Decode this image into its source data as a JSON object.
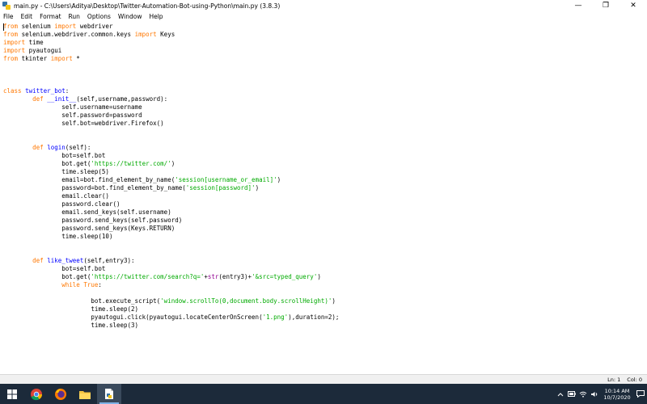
{
  "window": {
    "title": "main.py - C:\\Users\\Aditya\\Desktop\\Twitter-Automation-Bot-using-Python\\main.py (3.8.3)",
    "minimize_glyph": "—",
    "maximize_glyph": "❐",
    "close_glyph": "✕"
  },
  "menu": {
    "items": [
      "File",
      "Edit",
      "Format",
      "Run",
      "Options",
      "Window",
      "Help"
    ]
  },
  "code": {
    "lines": [
      [
        [
          "kw",
          "from"
        ],
        [
          "t",
          " selenium "
        ],
        [
          "kw",
          "import"
        ],
        [
          "t",
          " webdriver"
        ]
      ],
      [
        [
          "kw",
          "from"
        ],
        [
          "t",
          " selenium.webdriver.common.keys "
        ],
        [
          "kw",
          "import"
        ],
        [
          "t",
          " Keys"
        ]
      ],
      [
        [
          "kw",
          "import"
        ],
        [
          "t",
          " time"
        ]
      ],
      [
        [
          "kw",
          "import"
        ],
        [
          "t",
          " pyautogui"
        ]
      ],
      [
        [
          "kw",
          "from"
        ],
        [
          "t",
          " tkinter "
        ],
        [
          "kw",
          "import"
        ],
        [
          "t",
          " *"
        ]
      ],
      [],
      [],
      [],
      [
        [
          "kw",
          "class"
        ],
        [
          "t",
          " "
        ],
        [
          "def",
          "twitter_bot"
        ],
        [
          "t",
          ":"
        ]
      ],
      [
        [
          "t",
          "        "
        ],
        [
          "kw",
          "def"
        ],
        [
          "t",
          " "
        ],
        [
          "def",
          "__init__"
        ],
        [
          "t",
          "(self,username,password):"
        ]
      ],
      [
        [
          "t",
          "                self.username=username"
        ]
      ],
      [
        [
          "t",
          "                self.password=password"
        ]
      ],
      [
        [
          "t",
          "                self.bot=webdriver.Firefox()"
        ]
      ],
      [],
      [],
      [
        [
          "t",
          "        "
        ],
        [
          "kw",
          "def"
        ],
        [
          "t",
          " "
        ],
        [
          "def",
          "login"
        ],
        [
          "t",
          "(self):"
        ]
      ],
      [
        [
          "t",
          "                bot=self.bot"
        ]
      ],
      [
        [
          "t",
          "                bot.get("
        ],
        [
          "str",
          "'https://twitter.com/'"
        ],
        [
          "t",
          ")"
        ]
      ],
      [
        [
          "t",
          "                time.sleep(5)"
        ]
      ],
      [
        [
          "t",
          "                email=bot.find_element_by_name("
        ],
        [
          "str",
          "'session[username_or_email]'"
        ],
        [
          "t",
          ")"
        ]
      ],
      [
        [
          "t",
          "                password=bot.find_element_by_name("
        ],
        [
          "str",
          "'session[password]'"
        ],
        [
          "t",
          ")"
        ]
      ],
      [
        [
          "t",
          "                email.clear()"
        ]
      ],
      [
        [
          "t",
          "                password.clear()"
        ]
      ],
      [
        [
          "t",
          "                email.send_keys(self.username)"
        ]
      ],
      [
        [
          "t",
          "                password.send_keys(self.password)"
        ]
      ],
      [
        [
          "t",
          "                password.send_keys(Keys.RETURN)"
        ]
      ],
      [
        [
          "t",
          "                time.sleep(10)"
        ]
      ],
      [],
      [],
      [
        [
          "t",
          "        "
        ],
        [
          "kw",
          "def"
        ],
        [
          "t",
          " "
        ],
        [
          "def",
          "like_tweet"
        ],
        [
          "t",
          "(self,entry3):"
        ]
      ],
      [
        [
          "t",
          "                bot=self.bot"
        ]
      ],
      [
        [
          "t",
          "                bot.get("
        ],
        [
          "str",
          "'https://twitter.com/search?q='"
        ],
        [
          "t",
          "+"
        ],
        [
          "bi",
          "str"
        ],
        [
          "t",
          "(entry3)+"
        ],
        [
          "str",
          "'&src=typed_query'"
        ],
        [
          "t",
          ")"
        ]
      ],
      [
        [
          "t",
          "                "
        ],
        [
          "kw",
          "while"
        ],
        [
          "t",
          " "
        ],
        [
          "kw",
          "True"
        ],
        [
          "t",
          ":"
        ]
      ],
      [],
      [
        [
          "t",
          "                        bot.execute_script("
        ],
        [
          "str",
          "'window.scrollTo(0,document.body.scrollHeight)'"
        ],
        [
          "t",
          ")"
        ]
      ],
      [
        [
          "t",
          "                        time.sleep(2)"
        ]
      ],
      [
        [
          "t",
          "                        pyautogui.click(pyautogui.locateCenterOnScreen("
        ],
        [
          "str",
          "'1.png'"
        ],
        [
          "t",
          "),duration=2);"
        ]
      ],
      [
        [
          "t",
          "                        time.sleep(3)"
        ]
      ]
    ]
  },
  "status": {
    "line": "Ln: 1",
    "col": "Col: 0"
  },
  "taskbar": {
    "apps": [
      {
        "name": "start-button",
        "icon": "windows-logo-icon",
        "active": false
      },
      {
        "name": "taskbar-app-chrome",
        "icon": "chrome-icon",
        "active": false
      },
      {
        "name": "taskbar-app-firefox",
        "icon": "firefox-icon",
        "active": false
      },
      {
        "name": "taskbar-app-explorer",
        "icon": "folder-icon",
        "active": false
      },
      {
        "name": "taskbar-app-idle",
        "icon": "idle-editor-icon",
        "active": true
      }
    ],
    "time": "10:14 AM",
    "date": "10/7/2020"
  },
  "colors": {
    "keyword": "#ff7700",
    "string": "#00aa00",
    "definition": "#0000ff",
    "builtin": "#900090",
    "taskbar": "#1c2a3a"
  }
}
